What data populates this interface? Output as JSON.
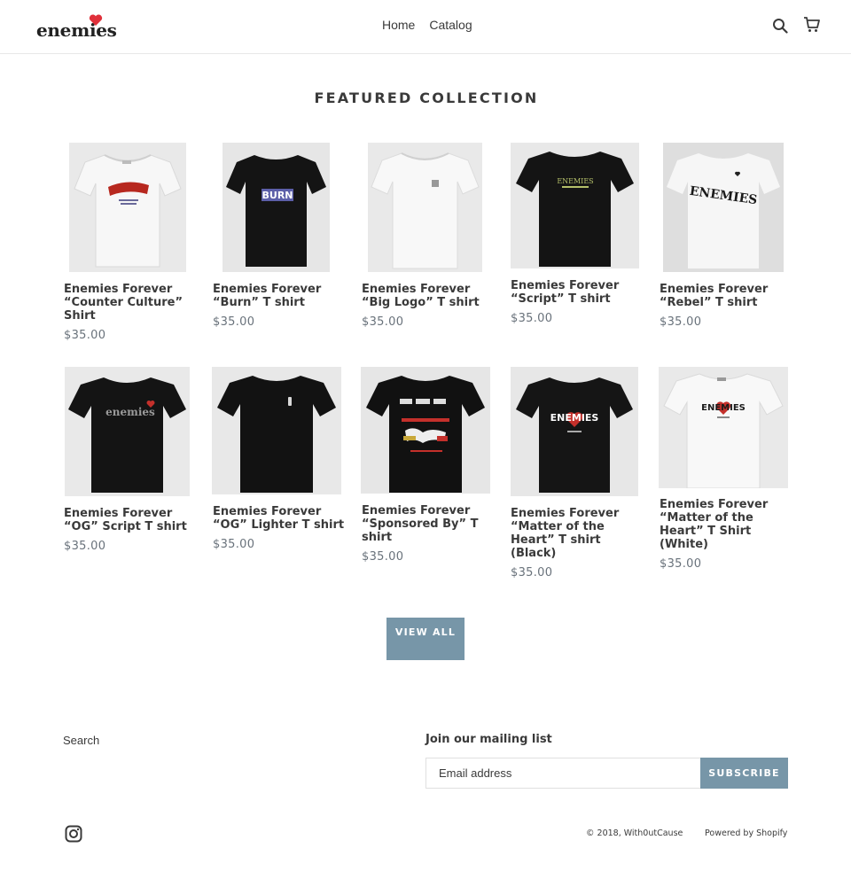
{
  "brand": {
    "name": "enemies",
    "heart_color": "#e0303a"
  },
  "nav": [
    {
      "label": "Home"
    },
    {
      "label": "Catalog"
    }
  ],
  "header_icons": {
    "search": "search-icon",
    "cart": "cart-icon"
  },
  "section": {
    "title": "FEATURED COLLECTION"
  },
  "products": [
    {
      "title": "Enemies Forever “Counter Culture” Shirt",
      "price": "$35.00",
      "shirt": "white",
      "graphic_text": ""
    },
    {
      "title": "Enemies Forever “Burn” T shirt",
      "price": "$35.00",
      "shirt": "black",
      "graphic_text": "BURN"
    },
    {
      "title": "Enemies Forever “Big Logo” T shirt",
      "price": "$35.00",
      "shirt": "white",
      "graphic_text": ""
    },
    {
      "title": "Enemies Forever “Script” T shirt",
      "price": "$35.00",
      "shirt": "black",
      "graphic_text": "ENEMIES"
    },
    {
      "title": "Enemies Forever “Rebel” T shirt",
      "price": "$35.00",
      "shirt": "white",
      "graphic_text": "ENEMIES"
    },
    {
      "title": "Enemies Forever “OG” Script T shirt",
      "price": "$35.00",
      "shirt": "black",
      "graphic_text": "enemies"
    },
    {
      "title": "Enemies Forever “OG” Lighter T shirt",
      "price": "$35.00",
      "shirt": "black",
      "graphic_text": ""
    },
    {
      "title": "Enemies Forever “Sponsored By” T shirt",
      "price": "$35.00",
      "shirt": "black",
      "graphic_text": ""
    },
    {
      "title": "Enemies Forever “Matter of the Heart” T shirt (Black)",
      "price": "$35.00",
      "shirt": "black",
      "graphic_text": "ENEMIES"
    },
    {
      "title": "Enemies Forever “Matter of the Heart” T Shirt (White)",
      "price": "$35.00",
      "shirt": "white",
      "graphic_text": "ENEMIES"
    }
  ],
  "view_all": {
    "label": "VIEW ALL"
  },
  "footer": {
    "search_link": "Search",
    "mailing_title": "Join our mailing list",
    "email_placeholder": "Email address",
    "subscribe_label": "SUBSCRIBE",
    "social_icon": "instagram-icon",
    "copyright": "© 2018, With0utCause",
    "powered_by": "Powered by Shopify"
  },
  "colors": {
    "accent": "#7796a8",
    "text": "#3a3a3a",
    "price": "#69727b"
  }
}
